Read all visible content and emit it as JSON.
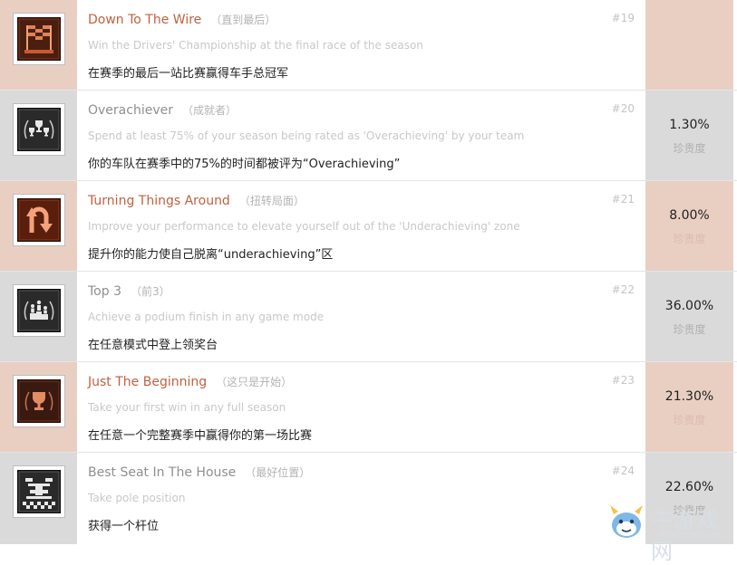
{
  "achievements": [
    {
      "id": "#19",
      "title": "Down To The Wire",
      "title_cn": "（直到最后）",
      "desc": "Win the Drivers' Championship at the final race of the season",
      "desc_cn": "在赛季的最后一站比赛赢得车手总冠军",
      "pct": "",
      "pct_label": "",
      "tier": "bronze",
      "icon": "podium-flags-icon"
    },
    {
      "id": "#20",
      "title": "Overachiever",
      "title_cn": "（成就者）",
      "desc": "Spend at least 75% of your season being rated as 'Overachieving' by your team",
      "desc_cn": "你的车队在赛季中的75%的时间都被评为“Overachieving”",
      "pct": "1.30%",
      "pct_label": "珍贵度",
      "tier": "silver",
      "icon": "trophies-laurel-icon"
    },
    {
      "id": "#21",
      "title": "Turning Things Around",
      "title_cn": "（扭转局面）",
      "desc": "Improve your performance to elevate yourself out of the 'Underachieving' zone",
      "desc_cn": "提升你的能力使自己脱离“underachieving”区",
      "pct": "8.00%",
      "pct_label": "珍贵度",
      "tier": "bronze",
      "icon": "u-turn-arrow-icon"
    },
    {
      "id": "#22",
      "title": "Top 3",
      "title_cn": "（前3）",
      "desc": "Achieve a podium finish in any game mode",
      "desc_cn": "在任意模式中登上领奖台",
      "pct": "36.00%",
      "pct_label": "珍贵度",
      "tier": "silver",
      "icon": "podium-laurel-icon"
    },
    {
      "id": "#23",
      "title": "Just The Beginning",
      "title_cn": "（这只是开始）",
      "desc": "Take your first win in any full season",
      "desc_cn": "在任意一个完整赛季中赢得你的第一场比赛",
      "pct": "21.30%",
      "pct_label": "珍贵度",
      "tier": "bronze",
      "icon": "trophy-laurel-icon"
    },
    {
      "id": "#24",
      "title": "Best Seat In The House",
      "title_cn": "（最好位置）",
      "desc": "Take pole position",
      "desc_cn": "获得一个杆位",
      "pct": "22.60%",
      "pct_label": "珍贵度",
      "tier": "silver",
      "icon": "grid-start-icon"
    }
  ],
  "watermark": {
    "text": "牛游戏网",
    "url": "www.newyx.net"
  }
}
